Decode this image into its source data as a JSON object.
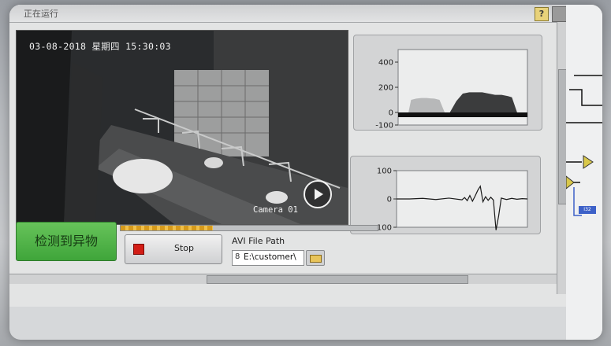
{
  "window": {
    "title": "正在运行",
    "help_glyph": "?"
  },
  "video": {
    "osd_datetime": "03-08-2018  星期四  15:30:03",
    "camera_label": "Camera 01",
    "play_icon": "play-icon"
  },
  "chart_data": [
    {
      "type": "area",
      "yticks": [
        "400",
        "200",
        "0",
        "-100"
      ],
      "ylim": [
        -100,
        500
      ],
      "x": [
        0,
        4,
        8,
        10,
        14,
        18,
        22,
        25,
        28,
        32,
        36,
        40,
        45,
        50,
        55,
        60,
        65,
        70,
        75,
        80,
        85,
        88,
        92,
        96,
        100
      ],
      "values": [
        0,
        0,
        0,
        100,
        110,
        115,
        115,
        112,
        110,
        100,
        0,
        0,
        0,
        0,
        0,
        0,
        0,
        0,
        0,
        0,
        0,
        0,
        0,
        0,
        0
      ],
      "shadow_values": [
        0,
        0,
        0,
        0,
        0,
        0,
        0,
        0,
        0,
        0,
        0,
        0,
        90,
        150,
        160,
        160,
        160,
        150,
        140,
        140,
        130,
        120,
        0,
        0,
        0
      ],
      "grid": false
    },
    {
      "type": "line",
      "yticks": [
        "100",
        "0",
        "-100"
      ],
      "ylim": [
        -100,
        100
      ],
      "x": [
        0,
        10,
        20,
        30,
        40,
        50,
        52,
        54,
        56,
        58,
        60,
        62,
        64,
        66,
        68,
        70,
        72,
        74,
        76,
        78,
        80,
        84,
        88,
        92,
        96,
        100
      ],
      "values": [
        0,
        0,
        2,
        -2,
        3,
        -3,
        5,
        -6,
        12,
        -8,
        10,
        30,
        45,
        -10,
        8,
        -5,
        6,
        -4,
        -110,
        -60,
        3,
        -2,
        2,
        -1,
        1,
        0
      ],
      "grid": false
    }
  ],
  "controls": {
    "alarm_text": "检测到异物",
    "progress": 0.36,
    "stop_label": "Stop",
    "avi_label": "AVI File Path",
    "path_glyph": "8",
    "path_value": "E:\\customer\\"
  },
  "diagram": {
    "wire_label": "I32"
  },
  "colors": {
    "alarm_green": "#4fb545",
    "stop_red": "#d21d16",
    "progress_orange": "#e0a52a"
  }
}
